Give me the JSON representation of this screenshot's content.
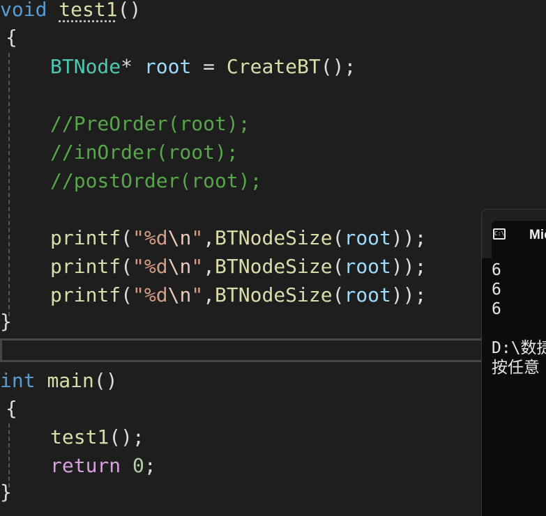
{
  "editor": {
    "lines": {
      "l1": {
        "kw": "void",
        "fn": "test1",
        "p": "()"
      },
      "l2": {
        "brace": "{"
      },
      "l3": {
        "type": "BTNode",
        "star": "*",
        "var": "root",
        "eq": " = ",
        "fn": "CreateBT",
        "p": "();"
      },
      "l5": {
        "cmt": "//PreOrder(root);"
      },
      "l6": {
        "cmt": "//inOrder(root);"
      },
      "l7": {
        "cmt": "//postOrder(root);"
      },
      "printf": {
        "fn": "printf",
        "open": "(",
        "q1": "\"",
        "fmt": "%d",
        "esc": "\\n",
        "q2": "\"",
        "comma": ",",
        "fn2": "BTNodeSize",
        "open2": "(",
        "var": "root",
        "close": "));"
      },
      "l12": {
        "brace": "}"
      },
      "l14": {
        "kw": "int",
        "sp": " ",
        "fn": "main",
        "p": "()"
      },
      "l15": {
        "brace": "{"
      },
      "l16": {
        "fn": "test1",
        "p": "();"
      },
      "l17": {
        "kw": "return",
        "sp": " ",
        "num": "0",
        "semi": ";"
      },
      "l18": {
        "brace": "}"
      }
    }
  },
  "console": {
    "icon_label": "C:\\",
    "icon_name": "terminal-icon",
    "title": "Mic",
    "output": [
      "6",
      "6",
      "6"
    ],
    "path_prefix": "D:\\数捷",
    "prompt_prefix": "按任意"
  }
}
